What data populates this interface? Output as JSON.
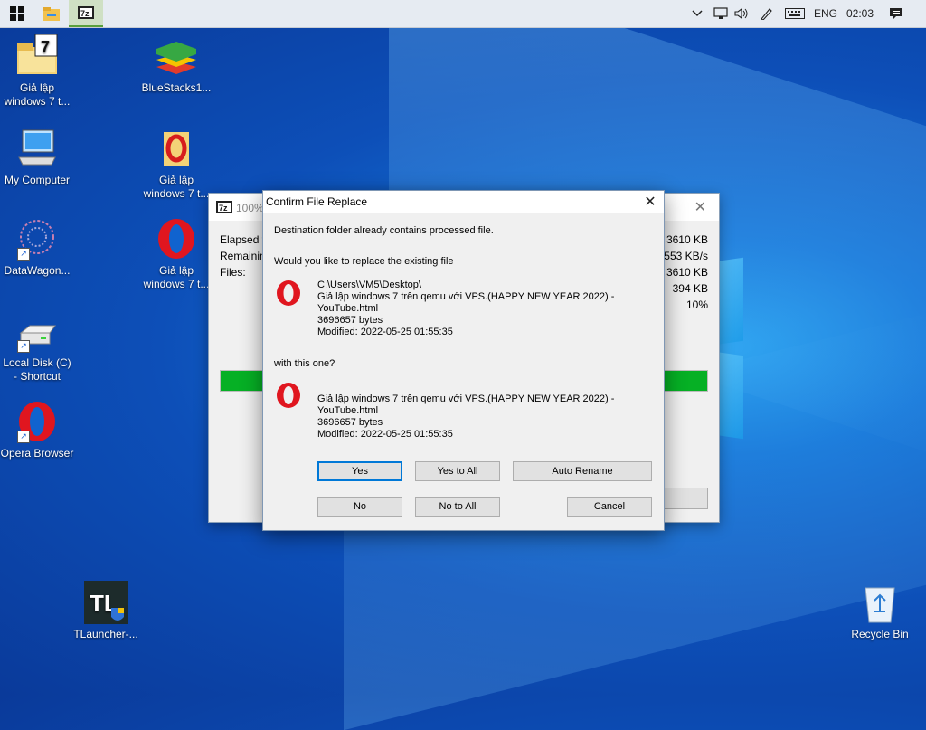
{
  "taskbar": {
    "tray_language": "ENG",
    "tray_time": "02:03"
  },
  "desktop_icons": [
    {
      "label": "Giả lập windows 7 t..."
    },
    {
      "label": "BlueStacks1..."
    },
    {
      "label": "My Computer"
    },
    {
      "label": "Giả lập windows 7 t..."
    },
    {
      "label": "DataWagon..."
    },
    {
      "label": "Giả lập windows 7 t..."
    },
    {
      "label": "Local Disk (C) - Shortcut"
    },
    {
      "label": "Opera Browser"
    },
    {
      "label": "TLauncher-..."
    },
    {
      "label": "Recycle Bin"
    }
  ],
  "progress_window": {
    "title": "100%",
    "labels": [
      "Elapsed tir",
      "Remaining",
      "Files:"
    ],
    "values": [
      "3610 KB",
      "3553 KB/s",
      "3610 KB",
      "394 KB",
      "10%"
    ],
    "progress_fraction": 1.0
  },
  "dialog": {
    "title": "Confirm File Replace",
    "message": "Destination folder already contains processed file.",
    "question": "Would you like to replace the existing file",
    "existing_file": {
      "path": "C:\\Users\\VM5\\Desktop\\",
      "name_line1": "Giả lập windows 7 trên qemu với VPS.(HAPPY NEW YEAR 2022) -",
      "name_line2": "YouTube.html",
      "size": "3696657 bytes",
      "modified": "Modified: 2022-05-25 01:55:35"
    },
    "with_this_one": "with this one?",
    "new_file": {
      "name_line1": "Giả lập windows 7 trên qemu với VPS.(HAPPY NEW YEAR 2022) -",
      "name_line2": "YouTube.html",
      "size": "3696657 bytes",
      "modified": "Modified: 2022-05-25 01:55:35"
    },
    "buttons": {
      "yes": "Yes",
      "yes_to_all": "Yes to All",
      "auto_rename": "Auto Rename",
      "no": "No",
      "no_to_all": "No to All",
      "cancel": "Cancel"
    }
  },
  "colors": {
    "accent": "#0078d7",
    "progress_green": "#06b025",
    "opera_red": "#e0161f"
  }
}
